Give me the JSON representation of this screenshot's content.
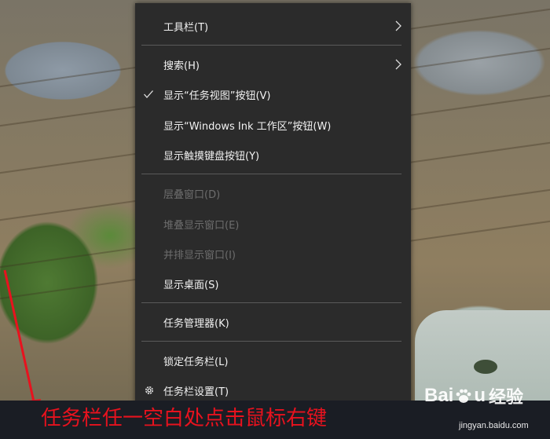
{
  "context_menu": {
    "items": [
      {
        "label": "工具栏(T)",
        "submenu": true,
        "enabled": true
      },
      {
        "label": "搜索(H)",
        "submenu": true,
        "enabled": true
      },
      {
        "label": "显示“任务视图”按钮(V)",
        "checked": true,
        "enabled": true
      },
      {
        "label": "显示“Windows Ink 工作区”按钮(W)",
        "enabled": true
      },
      {
        "label": "显示触摸键盘按钮(Y)",
        "enabled": true
      },
      {
        "label": "层叠窗口(D)",
        "enabled": false
      },
      {
        "label": "堆叠显示窗口(E)",
        "enabled": false
      },
      {
        "label": "并排显示窗口(I)",
        "enabled": false
      },
      {
        "label": "显示桌面(S)",
        "enabled": true
      },
      {
        "label": "任务管理器(K)",
        "enabled": true
      },
      {
        "label": "锁定任务栏(L)",
        "enabled": true
      },
      {
        "label": "任务栏设置(T)",
        "enabled": true,
        "icon": "gear-icon"
      }
    ]
  },
  "caption": {
    "text": "任务栏任一空白处点击鼠标右键",
    "color": "#e8121e"
  },
  "watermark": {
    "brand_left": "Bai",
    "brand_right": "u",
    "brand_cn": "经验",
    "url": "jingyan.baidu.com"
  },
  "colors": {
    "menu_bg": "#2b2b2b",
    "menu_text": "#f2f2f2",
    "menu_disabled": "#6d6d6d",
    "separator": "#5a5a5a"
  }
}
